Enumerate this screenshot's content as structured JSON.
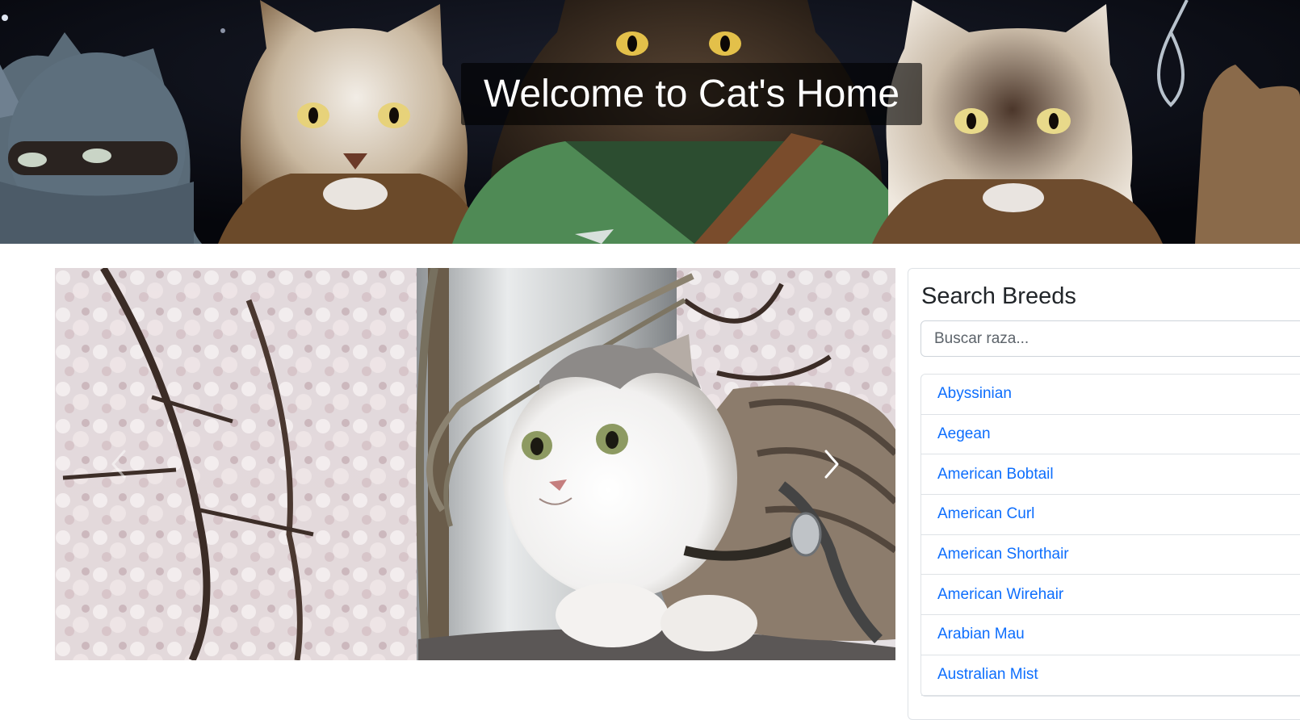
{
  "hero": {
    "title": "Welcome to Cat's Home",
    "image_icon": "cats-gang-banner-image"
  },
  "carousel": {
    "image_icon": "scottish-fold-cat-photo",
    "prev_icon": "chevron-left-icon",
    "next_icon": "chevron-right-icon"
  },
  "search": {
    "title": "Search Breeds",
    "placeholder": "Buscar raza..."
  },
  "breeds": [
    "Abyssinian",
    "Aegean",
    "American Bobtail",
    "American Curl",
    "American Shorthair",
    "American Wirehair",
    "Arabian Mau",
    "Australian Mist"
  ],
  "colors": {
    "link": "#0d6efd",
    "border": "#dee2e6",
    "text": "#212529"
  }
}
